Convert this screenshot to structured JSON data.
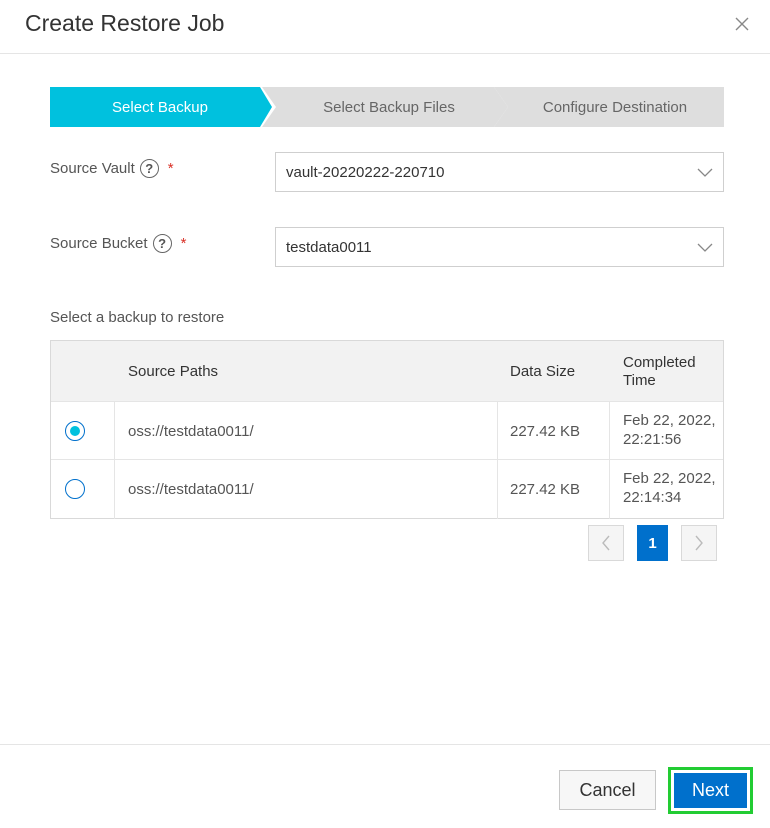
{
  "dialog": {
    "title": "Create Restore Job"
  },
  "steps": [
    {
      "label": "Select Backup",
      "active": true
    },
    {
      "label": "Select Backup Files",
      "active": false
    },
    {
      "label": "Configure Destination",
      "active": false
    }
  ],
  "form": {
    "source_vault": {
      "label": "Source Vault",
      "value": "vault-20220222-220710",
      "required_mark": "*"
    },
    "source_bucket": {
      "label": "Source Bucket",
      "value": "testdata0011",
      "required_mark": "*"
    }
  },
  "backup_table": {
    "section_label": "Select a backup to restore",
    "columns": [
      "Source Paths",
      "Data Size",
      "Completed",
      "Time"
    ],
    "rows": [
      {
        "selected": true,
        "path": "oss://testdata0011/",
        "size": "227.42 KB",
        "date": "Feb 22, 2022,",
        "time": "22:21:56"
      },
      {
        "selected": false,
        "path": "oss://testdata0011/",
        "size": "227.42 KB",
        "date": "Feb 22, 2022,",
        "time": "22:14:34"
      }
    ]
  },
  "pagination": {
    "current_page": "1"
  },
  "footer": {
    "cancel_label": "Cancel",
    "next_label": "Next"
  },
  "colors": {
    "accent": "#00c1de",
    "primary": "#0070cc",
    "highlight": "#22cc33",
    "required": "#d93026"
  },
  "icons": {
    "close": "close-icon",
    "dropdown": "chevron-down-icon",
    "help": "help-icon",
    "prev": "chevron-left-icon",
    "next": "chevron-right-icon"
  }
}
